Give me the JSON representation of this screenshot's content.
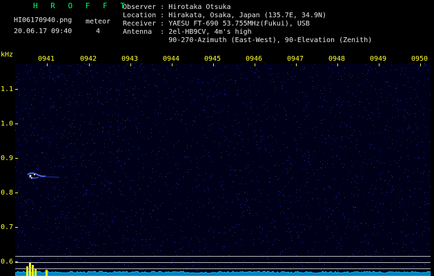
{
  "header": {
    "brand": "H R O F F T",
    "filename": "HI06170940.png",
    "datetime": "20.06.17 09:40",
    "meteor_label": "meteor",
    "meteor_count": "4"
  },
  "info": {
    "observer": "Observer : Hirotaka Otsuka",
    "location": "Location : Hirakata, Osaka, Japan (135.7E, 34.9N)",
    "receiver": "Receiver : YAESU FT-690 53.755MHz(Fukui), USB",
    "antenna": "Antenna  : 2el-HB9CV, 4m's high",
    "antenna2": "           90-270-Azimuth (East-West), 90-Elevation (Zenith)"
  },
  "axes": {
    "y_unit": "kHz",
    "y_ticks": [
      "1.1",
      "1.0",
      "0.9",
      "0.8",
      "0.7",
      "0.6"
    ],
    "x_ticks": [
      "0941",
      "0942",
      "0943",
      "0944",
      "0945",
      "0946",
      "0947",
      "0948",
      "0949",
      "0950"
    ]
  },
  "colors": {
    "background": "#000000",
    "plot_background": "#000018",
    "noise": "#1a1a8c",
    "signal": "#00c8ff",
    "peak": "#ffff00",
    "labels": "#ffff33",
    "brand": "#00ff66"
  }
}
